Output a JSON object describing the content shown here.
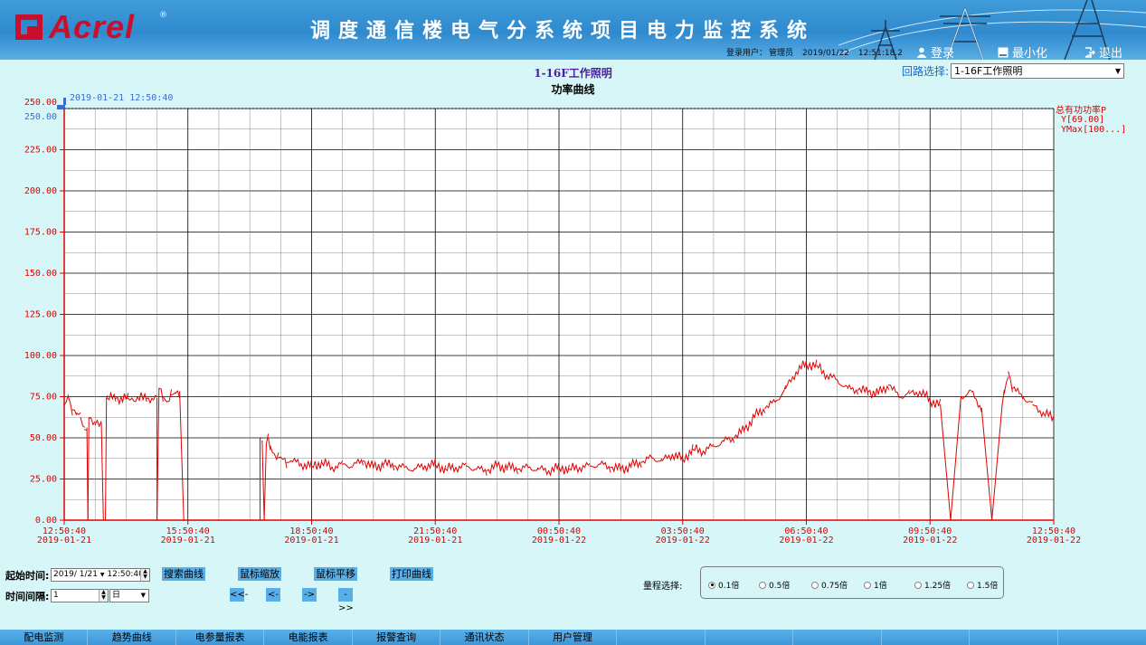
{
  "header": {
    "logo_text": "Acrel",
    "logo_reg": "®",
    "title": "调度通信楼电气分系统项目电力监控系统",
    "login_user_label": "登录用户：",
    "login_user": "管理员",
    "date": "2019/01/22",
    "time": "12:51:18.2",
    "login_btn": "登录",
    "minimize_btn": "最小化",
    "exit_btn": "退出"
  },
  "loop_select": {
    "label": "回路选择:",
    "value": "1-16F工作照明"
  },
  "chart_title": "1-16F工作照明",
  "chart_subtitle": "功率曲线",
  "chart_data": {
    "type": "line",
    "title": "1-16F工作照明",
    "subtitle": "功率曲线",
    "cursor_label": "2019-01-21 12:50:40",
    "cursor_value_label": "250.00",
    "ylim": [
      0,
      250
    ],
    "y_ticks": [
      "250.00",
      "225.00",
      "200.00",
      "175.00",
      "150.00",
      "125.00",
      "100.00",
      "75.00",
      "50.00",
      "25.00",
      "0.00"
    ],
    "x_ticks": [
      {
        "time": "12:50:40",
        "date": "2019-01-21"
      },
      {
        "time": "15:50:40",
        "date": "2019-01-21"
      },
      {
        "time": "18:50:40",
        "date": "2019-01-21"
      },
      {
        "time": "21:50:40",
        "date": "2019-01-21"
      },
      {
        "time": "00:50:40",
        "date": "2019-01-22"
      },
      {
        "time": "03:50:40",
        "date": "2019-01-22"
      },
      {
        "time": "06:50:40",
        "date": "2019-01-22"
      },
      {
        "time": "09:50:40",
        "date": "2019-01-22"
      },
      {
        "time": "12:50:40",
        "date": "2019-01-22"
      }
    ],
    "legend": {
      "name": "总有功功率P",
      "y": "Y[69.00]",
      "ymax": "YMax[100...]"
    },
    "grid": true,
    "series": [
      {
        "name": "总有功功率P",
        "color": "#e00000",
        "x_hours": [
          0,
          0.2,
          0.4,
          0.6,
          0.8,
          1.0,
          1.1,
          1.15,
          1.2,
          1.5,
          1.8,
          1.9,
          2.0,
          2.05,
          2.1,
          2.5,
          3.0,
          3.05,
          3.1,
          4.0,
          4.5,
          4.5,
          4.6,
          4.8,
          5.0,
          5.2,
          5.4,
          5.6,
          5.8,
          6.0,
          6.5,
          7.0,
          7.5,
          8.0,
          8.5,
          9.0,
          9.5,
          9.5,
          9.6,
          9.7,
          9.8,
          9.9,
          10.0,
          10.2,
          10.4,
          10.6,
          10.8,
          11.0,
          11.5,
          12.0,
          12.5,
          13.0,
          13.5,
          14.0,
          14.5,
          15.0,
          15.5,
          16.0,
          16.5,
          17.0,
          17.5,
          18.0,
          18.5,
          19.0,
          19.5,
          20.0,
          20.5,
          21.0,
          21.5,
          22.0,
          22.5,
          23.0,
          23.5,
          24.0,
          24.5,
          25.0,
          25.5,
          26.0,
          26.5,
          27.0,
          27.5,
          28.0,
          28.5,
          29.0,
          29.5,
          30.0,
          30.5,
          31.0,
          31.5,
          32.0,
          32.5,
          33.0,
          33.5,
          34.0,
          34.5,
          35.0,
          35.5,
          36.0,
          36.5,
          37.0,
          37.5,
          38.0,
          38.5,
          39.0,
          39.5,
          40.0,
          40.5,
          41.0,
          41.5,
          42.0,
          42.5,
          43.0,
          43.5,
          44.0,
          44.5,
          45.0,
          45.5,
          45.6,
          45.8,
          46.0,
          46.5,
          47.0,
          47.5,
          48.0
        ],
        "values": [
          70,
          75,
          67,
          65,
          62,
          55,
          56,
          0,
          62,
          58,
          59,
          0,
          0,
          74,
          74,
          74,
          74,
          74,
          74,
          74,
          74,
          0,
          80,
          75,
          72,
          76,
          77,
          78,
          0,
          0,
          0,
          0,
          0,
          0,
          0,
          0,
          0,
          50,
          48,
          0,
          46,
          50,
          45,
          40,
          38,
          37,
          35,
          36,
          34,
          33,
          35,
          32,
          34,
          33,
          36,
          32,
          34,
          33,
          32,
          31,
          33,
          34,
          31,
          32,
          33,
          31,
          30,
          33,
          32,
          31,
          32,
          31,
          30,
          32,
          31,
          32,
          33,
          34,
          32,
          31,
          33,
          35,
          38,
          36,
          40,
          37,
          43,
          42,
          45,
          48,
          50,
          55,
          63,
          68,
          72,
          80,
          90,
          95,
          94,
          88,
          85,
          80,
          79,
          78,
          77,
          82,
          75,
          77,
          78,
          73,
          70,
          0,
          75,
          78,
          68,
          0,
          70,
          77,
          90,
          80,
          75,
          70,
          65,
          62,
          58,
          60
        ]
      }
    ]
  },
  "controls": {
    "start_time_label": "起始时间:",
    "start_date_value": "2019/ 1/21",
    "start_time_value": "12:50:40",
    "interval_label": "时间间隔:",
    "interval_value": "1",
    "interval_unit": "日",
    "search_btn": "搜索曲线",
    "zoom_btn": "鼠标缩放",
    "pan_btn": "鼠标平移",
    "print_btn": "打印曲线",
    "nav_first": "<<-",
    "nav_prev": "<-",
    "nav_next": "->",
    "nav_last": "->>",
    "range_label": "量程选择:",
    "range_options": [
      "0.1倍",
      "0.5倍",
      "0.75倍",
      "1倍",
      "1.25倍",
      "1.5倍"
    ],
    "range_selected": "0.1倍"
  },
  "bottom_nav": [
    "配电监测",
    "趋势曲线",
    "电参量报表",
    "电能报表",
    "报警查询",
    "通讯状态",
    "用户管理",
    "",
    "",
    "",
    "",
    "",
    ""
  ]
}
